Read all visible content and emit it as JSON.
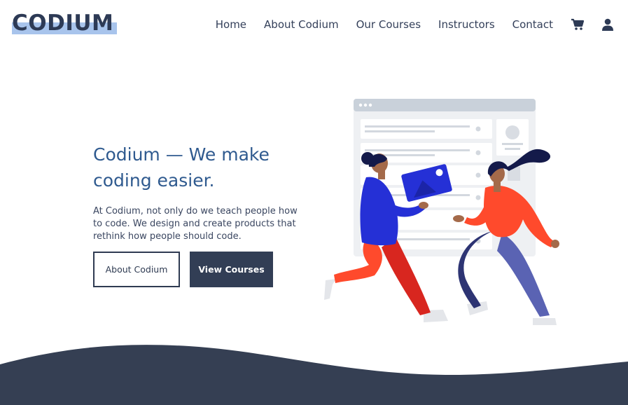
{
  "brand": {
    "logo_text": "CODIUM"
  },
  "nav": {
    "links": [
      "Home",
      "About Codium",
      "Our Courses",
      "Instructors",
      "Contact"
    ],
    "icons": [
      "cart-icon",
      "user-icon"
    ]
  },
  "hero": {
    "title": "Codium — We make coding easier.",
    "description": "At Codium, not only do we teach people how to code. We design and create products that rethink how people should code.",
    "buttons": {
      "about": "About Codium",
      "courses": "View Courses"
    }
  },
  "colors": {
    "accent": "#2f5a8f",
    "dark": "#323e55",
    "logo_highlight": "#a8c4ec",
    "footer_wave": "#353f53"
  }
}
